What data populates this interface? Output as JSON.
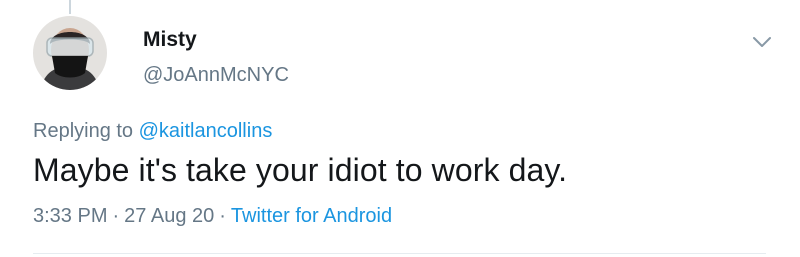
{
  "user": {
    "display_name": "Misty",
    "handle": "@JoAnnMcNYC",
    "avatar": "user-photo-with-mask"
  },
  "reply": {
    "prefix": "Replying to",
    "mention": "@kaitlancollins"
  },
  "tweet": {
    "text": "Maybe it's take your idiot to work day."
  },
  "meta": {
    "time": "3:33 PM",
    "separator": "·",
    "date": "27 Aug 20",
    "source": "Twitter for Android"
  },
  "icons": {
    "menu": "chevron-down-icon"
  },
  "colors": {
    "primary_text": "#14171a",
    "secondary_text": "#657786",
    "link": "#1b95e0",
    "divider": "#e6ecf0"
  }
}
